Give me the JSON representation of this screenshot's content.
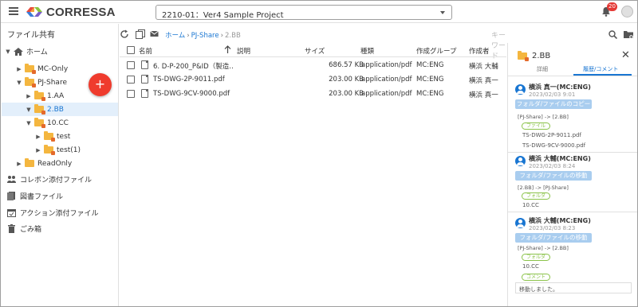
{
  "header": {
    "logo_text": "CORRESSA",
    "project": "2210-01：Ver4 Sample Project",
    "notification_count": "20"
  },
  "sidebar": {
    "title": "ファイル共有",
    "fab_label": "+",
    "tree": [
      {
        "label": "ホーム",
        "expanded": true
      },
      {
        "label": "MC-Only",
        "expanded": false
      },
      {
        "label": "PJ-Share",
        "expanded": true
      },
      {
        "label": "1.AA",
        "expanded": false
      },
      {
        "label": "2.BB",
        "expanded": true,
        "selected": true
      },
      {
        "label": "10.CC",
        "expanded": true
      },
      {
        "label": "test",
        "expanded": false
      },
      {
        "label": "test(1)",
        "expanded": false
      },
      {
        "label": "ReadOnly",
        "expanded": false
      }
    ],
    "links": [
      {
        "label": "コレボン添付ファイル",
        "icon": "people-icon"
      },
      {
        "label": "図書ファイル",
        "icon": "document-icon"
      },
      {
        "label": "アクション添付ファイル",
        "icon": "calendar-icon"
      },
      {
        "label": "ごみ箱",
        "icon": "trash-icon"
      }
    ]
  },
  "toolbar": {
    "breadcrumb": [
      "ホーム",
      "PJ-Share",
      "2.BB"
    ],
    "breadcrumb_sep": "›",
    "search_placeholder": "キーワード"
  },
  "table": {
    "columns": [
      "名前",
      "説明",
      "サイズ",
      "種類",
      "作成グループ",
      "作成者"
    ],
    "rows": [
      {
        "name": "6. D-P-200_P&ID（製造…",
        "description": "",
        "size": "686.57 KB",
        "type": "application/pdf",
        "group": "MC:ENG",
        "author": "横浜 大輔"
      },
      {
        "name": "TS-DWG-2P-9011.pdf",
        "description": "",
        "size": "203.00 KB",
        "type": "application/pdf",
        "group": "MC:ENG",
        "author": "横浜 真一"
      },
      {
        "name": "TS-DWG-9CV-9000.pdf",
        "description": "",
        "size": "203.00 KB",
        "type": "application/pdf",
        "group": "MC:ENG",
        "author": "横浜 真一"
      }
    ]
  },
  "panel": {
    "title": "2.BB",
    "close": "✕",
    "tabs": [
      "詳細",
      "履歴/コメント"
    ],
    "history": [
      {
        "user": "横浜 真一(MC:ENG)",
        "date": "2023/02/03 9:01",
        "action": "フォルダ/ファイルのコピー",
        "path": "[PJ-Share] -> [2.BB]",
        "chip": "ファイル",
        "files": [
          "TS-DWG-2P-9011.pdf",
          "TS-DWG-9CV-9000.pdf"
        ]
      },
      {
        "user": "横浜 大輔(MC:ENG)",
        "date": "2023/02/03 8:24",
        "action": "フォルダ/ファイルの移動",
        "path": "[2.BB] -> [PJ-Share]",
        "chip": "フォルダ",
        "files": [
          "10.CC"
        ]
      },
      {
        "user": "横浜 大輔(MC:ENG)",
        "date": "2023/02/03 8:23",
        "action": "フォルダ/ファイルの移動",
        "path": "[PJ-Share] -> [2.BB]",
        "chip": "フォルダ",
        "files": [
          "10.CC"
        ],
        "comment_chip": "コメント",
        "comment": "移動しました。"
      }
    ]
  },
  "colors": {
    "accent": "#1976d2",
    "fab": "#ef3b2d",
    "folder": "#f4b63f",
    "action_chip": "#a9cdef",
    "tag": "#8bc34a"
  }
}
